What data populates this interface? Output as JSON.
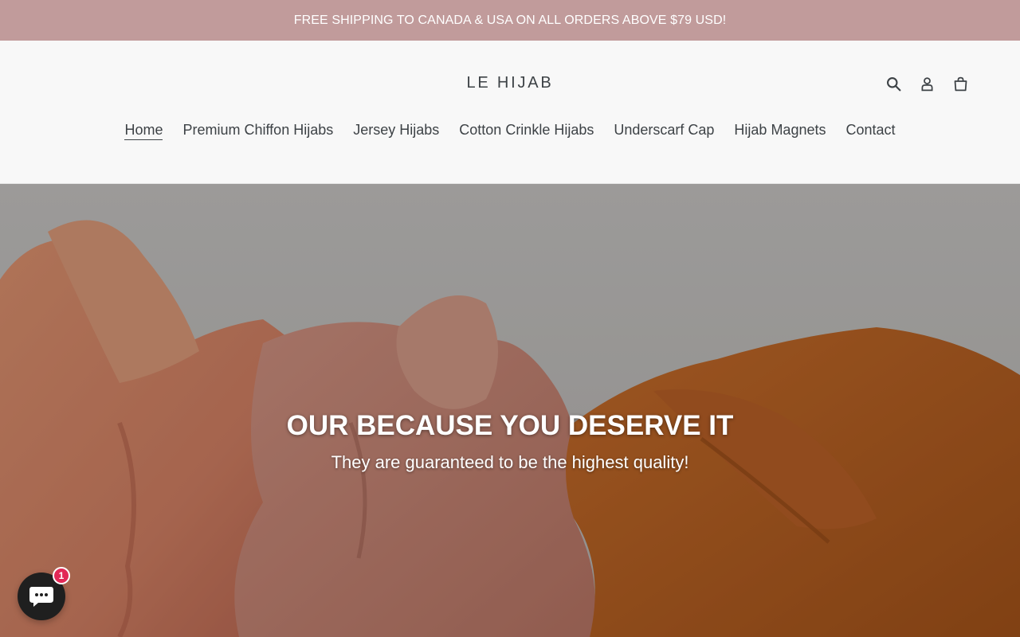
{
  "announcement": {
    "text": "FREE SHIPPING TO CANADA & USA ON ALL ORDERS ABOVE $79 USD!",
    "background": "#c19b9b",
    "color": "#ffffff"
  },
  "header": {
    "logo": "LE HIJAB",
    "icons": [
      "search-icon",
      "account-icon",
      "cart-icon"
    ]
  },
  "nav": {
    "items": [
      {
        "label": "Home",
        "active": true
      },
      {
        "label": "Premium Chiffon Hijabs"
      },
      {
        "label": "Jersey Hijabs"
      },
      {
        "label": "Cotton Crinkle Hijabs"
      },
      {
        "label": "Underscarf Cap"
      },
      {
        "label": "Hijab Magnets"
      },
      {
        "label": "Contact"
      }
    ]
  },
  "hero": {
    "title": "OUR BECAUSE YOU DESERVE IT",
    "subtitle": "They are guaranteed to be the highest quality!"
  },
  "chat": {
    "badge_count": "1"
  },
  "colors": {
    "text": "#3d4246",
    "header_bg": "#f8f8f8",
    "badge": "#e22856",
    "chat_bg": "#1f1f1f"
  }
}
